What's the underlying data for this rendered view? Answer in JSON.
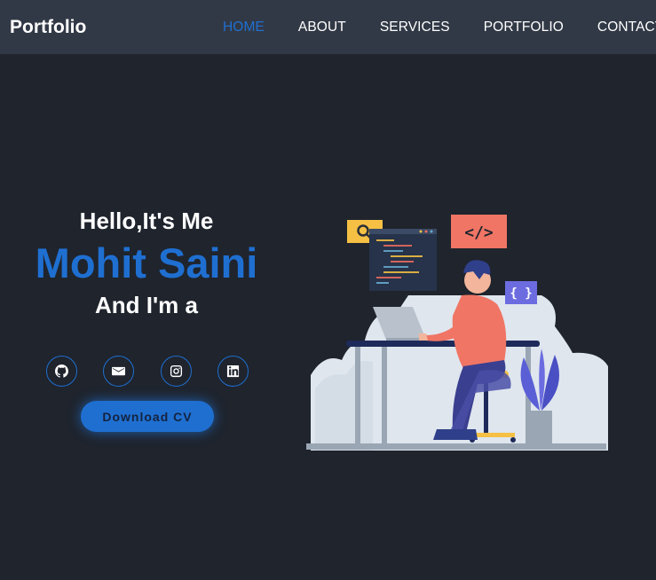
{
  "header": {
    "brand": "Portfolio",
    "nav": [
      "HOME",
      "ABOUT",
      "SERVICES",
      "PORTFOLIO",
      "CONTACT"
    ],
    "active": "HOME"
  },
  "hero": {
    "greeting": "Hello,It's Me",
    "name": "Mohit Saini",
    "role_prefix": "And I'm a",
    "download_button": "Download CV",
    "socials": [
      "github-icon",
      "email-icon",
      "instagram-icon",
      "linkedin-icon"
    ]
  },
  "illustration": {
    "code_tag": "</>",
    "braces_tag": "{ }"
  },
  "colors": {
    "background": "#1f242d",
    "navbar": "#323946",
    "accent": "#1f6fd1"
  }
}
